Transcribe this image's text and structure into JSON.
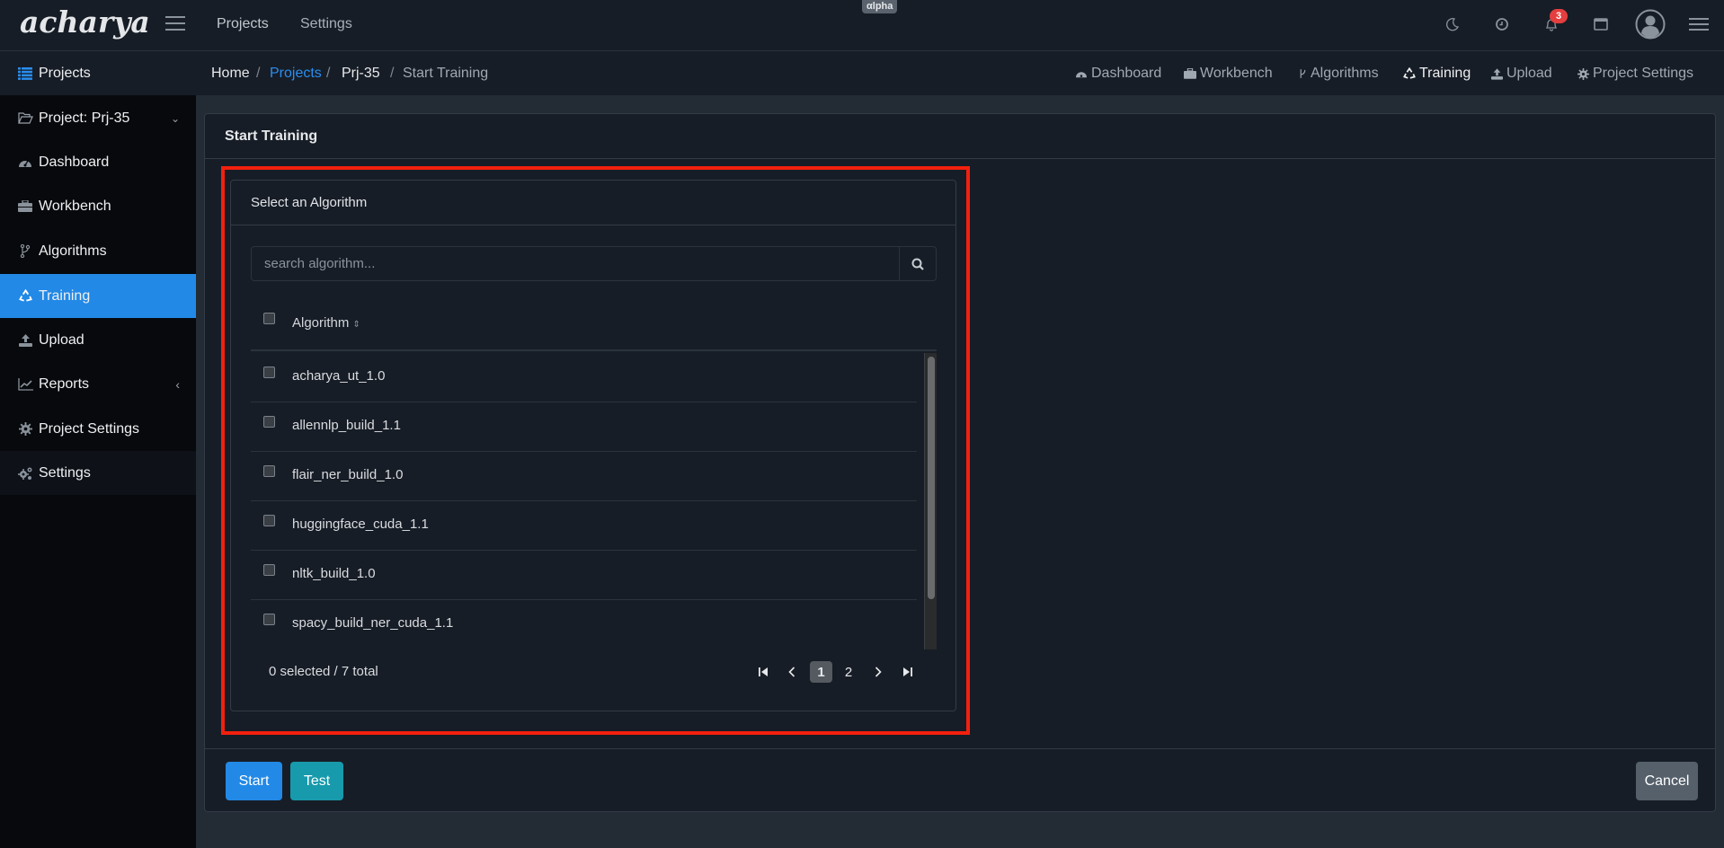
{
  "topbar": {
    "logo": "acharya",
    "nav_links": [
      "Projects",
      "Settings"
    ],
    "alpha_badge": "αlpha",
    "notification_count": "3",
    "icons": [
      "moon-icon",
      "clock-icon",
      "bell-icon",
      "window-icon",
      "user-avatar-icon",
      "menu-icon"
    ]
  },
  "sidebar": {
    "items": [
      {
        "label": "Projects",
        "icon": "list-icon"
      },
      {
        "label": "Project: Prj-35",
        "icon": "folder-open-icon"
      },
      {
        "label": "Dashboard",
        "icon": "dashboard-icon"
      },
      {
        "label": "Workbench",
        "icon": "toolbox-icon"
      },
      {
        "label": "Algorithms",
        "icon": "code-branch-icon"
      },
      {
        "label": "Training",
        "icon": "recycle-icon",
        "active": true
      },
      {
        "label": "Upload",
        "icon": "upload-icon"
      },
      {
        "label": "Reports",
        "icon": "chart-line-icon"
      },
      {
        "label": "Project Settings",
        "icon": "gear-icon"
      },
      {
        "label": "Settings",
        "icon": "gears-icon"
      }
    ]
  },
  "breadcrumb": [
    "Home",
    "Projects",
    "Prj-35",
    "Start Training"
  ],
  "subnav": [
    "Dashboard",
    "Workbench",
    "Algorithms",
    "Training",
    "Upload",
    "Project Settings"
  ],
  "card": {
    "title": "Start Training",
    "algo_panel": {
      "title": "Select an Algorithm",
      "search_placeholder": "search algorithm...",
      "column_header": "Algorithm",
      "rows": [
        "acharya_ut_1.0",
        "allennlp_build_1.1",
        "flair_ner_build_1.0",
        "huggingface_cuda_1.1",
        "nltk_build_1.0",
        "spacy_build_ner_cuda_1.1"
      ],
      "selection_summary": "0 selected / 7 total",
      "pagination": {
        "current_page": "1",
        "pages": [
          "1",
          "2"
        ]
      }
    },
    "buttons": {
      "start": "Start",
      "test": "Test",
      "cancel": "Cancel"
    }
  },
  "colors": {
    "accent": "#2289e6",
    "info": "#17a2b8",
    "secondary": "#5a6570",
    "highlight": "#f3200e",
    "badge": "#e53e3e"
  }
}
